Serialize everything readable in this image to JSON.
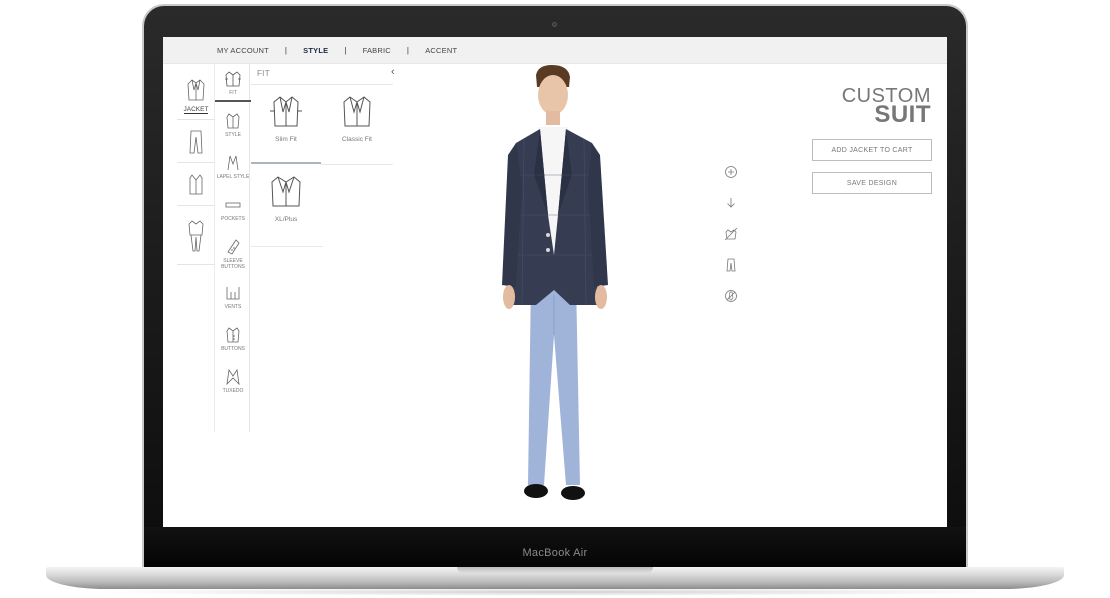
{
  "device": {
    "label": "MacBook Air"
  },
  "nav": {
    "items": [
      {
        "label": "MY ACCOUNT",
        "active": false
      },
      {
        "label": "STYLE",
        "active": true
      },
      {
        "label": "FABRIC",
        "active": false
      },
      {
        "label": "ACCENT",
        "active": false
      }
    ],
    "separator": "|"
  },
  "products": {
    "jacket_label": "JACKET"
  },
  "style_options": [
    {
      "label": "FIT",
      "icon": "jacket-fit-icon"
    },
    {
      "label": "STYLE",
      "icon": "jacket-style-icon"
    },
    {
      "label": "LAPEL STYLE",
      "icon": "lapel-icon"
    },
    {
      "label": "POCKETS",
      "icon": "pocket-icon"
    },
    {
      "label": "SLEEVE BUTTONS",
      "icon": "sleeve-buttons-icon"
    },
    {
      "label": "VENTS",
      "icon": "vents-icon"
    },
    {
      "label": "BUTTONS",
      "icon": "buttons-icon"
    },
    {
      "label": "TUXEDO",
      "icon": "tuxedo-icon"
    }
  ],
  "fit_panel": {
    "header": "FIT",
    "options": [
      {
        "label": "Slim Fit",
        "selected": true
      },
      {
        "label": "Classic Fit",
        "selected": false
      },
      {
        "label": "XL/Plus",
        "selected": false
      }
    ]
  },
  "title": {
    "line1": "CUSTOM",
    "line2": "SUIT"
  },
  "actions": {
    "add_to_cart": "ADD JACKET TO CART",
    "save_design": "SAVE DESIGN"
  },
  "tools": [
    "zoom-in-icon",
    "download-icon",
    "hide-jacket-icon",
    "pants-icon",
    "no-tie-icon"
  ],
  "colors": {
    "jacket": "#363d52",
    "pants": "#9fb4d8",
    "accent": "#1b2a44"
  }
}
